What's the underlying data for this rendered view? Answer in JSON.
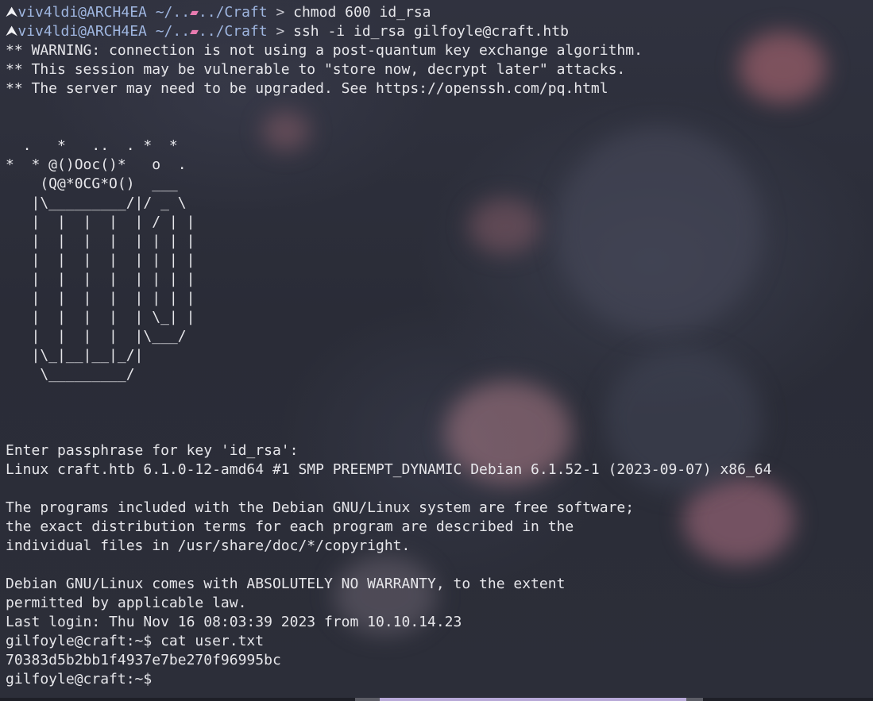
{
  "session": {
    "prompt1": {
      "arrow": "⮝",
      "user_host": "viv4ldi@ARCH4EA",
      "path_prefix": " ~/..",
      "path_suffix": "../Craft",
      "chevron": " > ",
      "command": "chmod 600 id_rsa"
    },
    "prompt2": {
      "arrow": "⮝",
      "user_host": "viv4ldi@ARCH4EA",
      "path_prefix": " ~/..",
      "path_suffix": "../Craft",
      "chevron": " > ",
      "command": "ssh -i id_rsa gilfoyle@craft.htb"
    },
    "warnings": [
      "** WARNING: connection is not using a post-quantum key exchange algorithm.",
      "** This session may be vulnerable to \"store now, decrypt later\" attacks.",
      "** The server may need to be upgraded. See https://openssh.com/pq.html"
    ],
    "banner_art": [
      "  .   *   ..  . *  *",
      "*  * @()Ooc()*   o  .",
      "    (Q@*0CG*O()  ___",
      "   |\\_________/|/ _ \\",
      "   |  |  |  |  | / | |",
      "   |  |  |  |  | | | |",
      "   |  |  |  |  | | | |",
      "   |  |  |  |  | | | |",
      "   |  |  |  |  | | | |",
      "   |  |  |  |  | \\_| |",
      "   |  |  |  |  |\\___/",
      "   |\\_|__|__|_/|",
      "    \\_________/"
    ],
    "passphrase_prompt": "Enter passphrase for key 'id_rsa':",
    "uname": "Linux craft.htb 6.1.0-12-amd64 #1 SMP PREEMPT_DYNAMIC Debian 6.1.52-1 (2023-09-07) x86_64",
    "motd": [
      "The programs included with the Debian GNU/Linux system are free software;",
      "the exact distribution terms for each program are described in the",
      "individual files in /usr/share/doc/*/copyright."
    ],
    "warranty": [
      "Debian GNU/Linux comes with ABSOLUTELY NO WARRANTY, to the extent",
      "permitted by applicable law."
    ],
    "last_login": "Last login: Thu Nov 16 08:03:39 2023 from 10.10.14.23",
    "remote_cmd_line": "gilfoyle@craft:~$ cat user.txt",
    "flag_output": "70383d5b2bb1f4937e7be270f96995bc",
    "remote_prompt": "gilfoyle@craft:~$ "
  },
  "icons": {
    "prompt_arrow": "arch-logo-icon",
    "folder": "folder-icon"
  },
  "colors": {
    "background": "#2b2d38",
    "text": "#e6e6ea",
    "prompt_user": "#9fb6e0",
    "folder_icon": "#e87bb0",
    "scroll_accent": "#b8a9d8"
  }
}
